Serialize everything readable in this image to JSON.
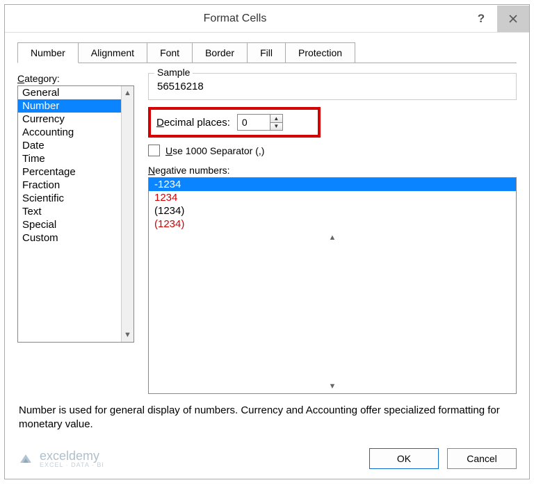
{
  "title": "Format Cells",
  "tabs": [
    "Number",
    "Alignment",
    "Font",
    "Border",
    "Fill",
    "Protection"
  ],
  "active_tab": 0,
  "category_label": "Category:",
  "categories": [
    "General",
    "Number",
    "Currency",
    "Accounting",
    "Date",
    "Time",
    "Percentage",
    "Fraction",
    "Scientific",
    "Text",
    "Special",
    "Custom"
  ],
  "selected_category": 1,
  "sample_label": "Sample",
  "sample_value": "56516218",
  "decimal_label": "Decimal places:",
  "decimal_value": "0",
  "separator_label": "Use 1000 Separator (,)",
  "negative_label": "Negative numbers:",
  "negative_items": [
    {
      "text": "-1234",
      "color": "black",
      "selected": true
    },
    {
      "text": "1234",
      "color": "red",
      "selected": false
    },
    {
      "text": "(1234)",
      "color": "black",
      "selected": false
    },
    {
      "text": "(1234)",
      "color": "red",
      "selected": false
    }
  ],
  "description": "Number is used for general display of numbers.  Currency and Accounting offer specialized formatting for monetary value.",
  "buttons": {
    "ok": "OK",
    "cancel": "Cancel"
  },
  "watermark": {
    "brand": "exceldemy",
    "sub": "EXCEL · DATA · BI"
  },
  "accent_color": "#0a84ff",
  "highlight_color": "#d40000"
}
